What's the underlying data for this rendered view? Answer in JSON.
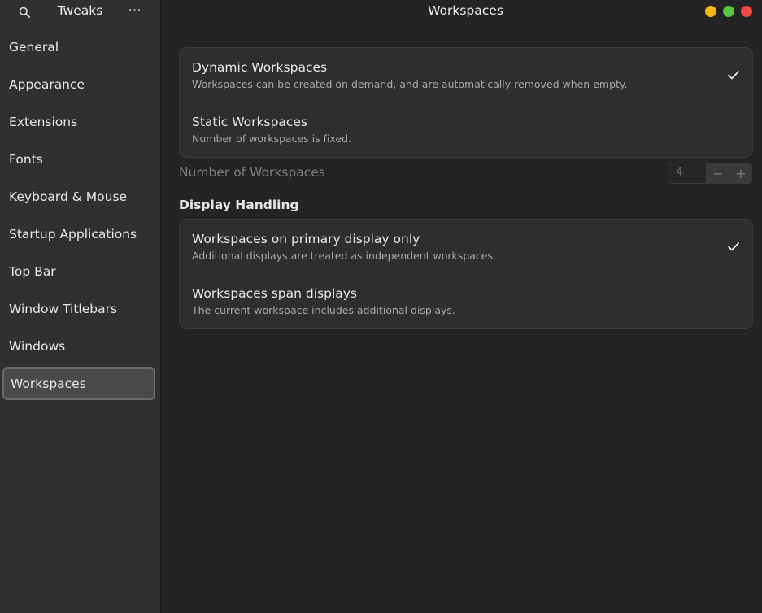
{
  "sidebar": {
    "title": "Tweaks",
    "menu_glyph": "···",
    "items": [
      {
        "label": "General"
      },
      {
        "label": "Appearance"
      },
      {
        "label": "Extensions"
      },
      {
        "label": "Fonts"
      },
      {
        "label": "Keyboard & Mouse"
      },
      {
        "label": "Startup Applications"
      },
      {
        "label": "Top Bar"
      },
      {
        "label": "Window Titlebars"
      },
      {
        "label": "Windows"
      },
      {
        "label": "Workspaces"
      }
    ],
    "active": "Workspaces"
  },
  "main": {
    "title": "Workspaces",
    "workspace_mode": {
      "options": [
        {
          "title": "Dynamic Workspaces",
          "subtitle": "Workspaces can be created on demand, and are automatically removed when empty.",
          "selected": true
        },
        {
          "title": "Static Workspaces",
          "subtitle": "Number of workspaces is fixed.",
          "selected": false
        }
      ]
    },
    "number_of_workspaces": {
      "label": "Number of Workspaces",
      "value": "4",
      "minus": "−",
      "plus": "+"
    },
    "display_handling": {
      "heading": "Display Handling",
      "options": [
        {
          "title": "Workspaces on primary display only",
          "subtitle": "Additional displays are treated as independent workspaces.",
          "selected": true
        },
        {
          "title": "Workspaces span displays",
          "subtitle": "The current workspace includes additional displays.",
          "selected": false
        }
      ]
    }
  },
  "icons": {
    "search": "search-icon",
    "menu": "more-icon",
    "check": "checkmark-icon"
  },
  "colors": {
    "minimize": "#f5b618",
    "maximize": "#5ac83c",
    "close": "#ec4a44"
  }
}
